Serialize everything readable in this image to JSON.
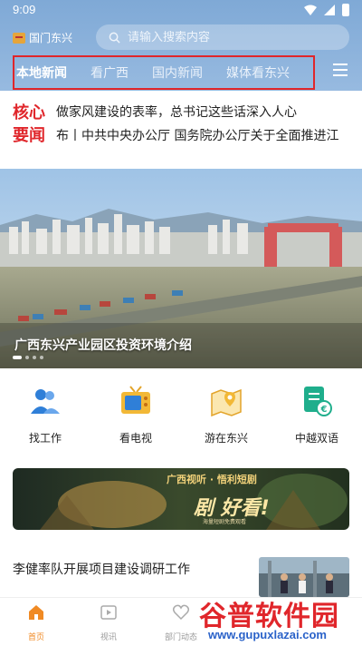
{
  "status_bar": {
    "time": "9:09"
  },
  "header": {
    "logo_text": "国门东兴",
    "search": {
      "placeholder": "请输入搜索内容"
    },
    "tabs": [
      {
        "label": "本地新闻",
        "active": true
      },
      {
        "label": "看广西",
        "active": false
      },
      {
        "label": "国内新闻",
        "active": false
      },
      {
        "label": "媒体看东兴",
        "active": false
      }
    ],
    "highlight_color": "#e0262b",
    "accent_color": "#f08a24"
  },
  "core_news": {
    "label": "核心要闻",
    "headlines": [
      "做家风建设的表率，总书记这些话深入人心",
      "布丨中共中央办公厅 国务院办公厅关于全面推进江"
    ]
  },
  "banner": {
    "caption": "广西东兴产业园区投资环境介绍",
    "slide_count": 4,
    "current_slide": 1
  },
  "services": [
    {
      "label": "找工作",
      "icon": "job-icon"
    },
    {
      "label": "看电视",
      "icon": "tv-icon"
    },
    {
      "label": "游在东兴",
      "icon": "map-icon"
    },
    {
      "label": "中越双语",
      "icon": "bilingual-icon"
    }
  ],
  "promo": {
    "line1": "广西视听 · 悟利短剧",
    "line2": "剧 好看!",
    "line3": "海量短剧免费观看"
  },
  "news_item": {
    "title": "李健率队开展项目建设调研工作"
  },
  "bottom_nav": [
    {
      "label": "首页",
      "icon": "home-icon",
      "active": true
    },
    {
      "label": "视讯",
      "icon": "video-icon",
      "active": false
    },
    {
      "label": "部门动态",
      "icon": "heart-icon",
      "active": false
    }
  ],
  "watermark": {
    "line1": "谷普软件园",
    "line2": "www.gupuxlazai.com"
  }
}
